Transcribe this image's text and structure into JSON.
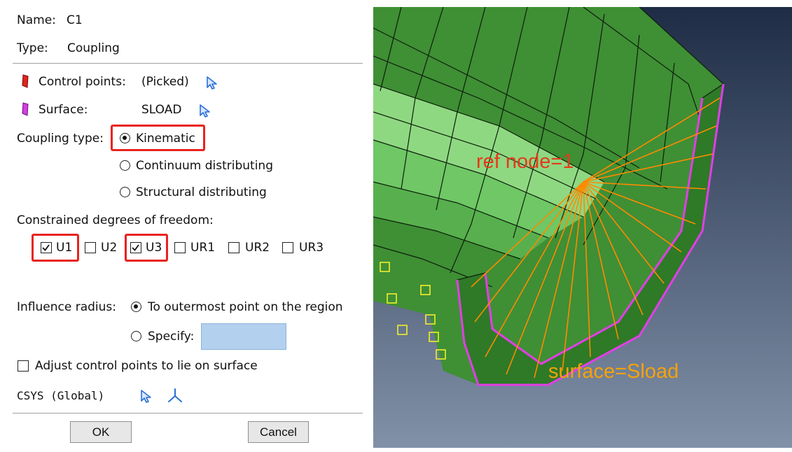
{
  "dialog": {
    "name_label": "Name:",
    "name_value": "C1",
    "type_label": "Type:",
    "type_value": "Coupling",
    "control_points_label": "Control points:",
    "control_points_value": "(Picked)",
    "surface_label": "Surface:",
    "surface_value": "SLOAD",
    "coupling_type_label": "Coupling type:",
    "coupling_options": [
      "Kinematic",
      "Continuum distributing",
      "Structural distributing"
    ],
    "coupling_selected": "Kinematic",
    "dof_label": "Constrained degrees of freedom:",
    "dof": [
      {
        "label": "U1",
        "checked": true
      },
      {
        "label": "U2",
        "checked": false
      },
      {
        "label": "U3",
        "checked": true
      },
      {
        "label": "UR1",
        "checked": false
      },
      {
        "label": "UR2",
        "checked": false
      },
      {
        "label": "UR3",
        "checked": false
      }
    ],
    "influence_label": "Influence radius:",
    "influence_outermost": "To outermost point on the region",
    "influence_specify": "Specify:",
    "influence_specify_value": "",
    "adjust_label": "Adjust control points to lie on surface",
    "adjust_checked": false,
    "csys_label": "CSYS (Global)",
    "ok_label": "OK",
    "cancel_label": "Cancel"
  },
  "viewport": {
    "ref_node_label": "ref node=1",
    "surface_label": "surface=Sload"
  },
  "colors": {
    "highlight_box": "#e8231e",
    "annotation_ref": "#e53a1a",
    "annotation_surface": "#f5a20a",
    "mesh_green": "#3f8f35",
    "surface_magenta": "#e23ee6",
    "coupling_orange": "#ff8a00",
    "viewport_bg_top": "#1e2c45",
    "viewport_bg_bottom": "#8191a8"
  }
}
